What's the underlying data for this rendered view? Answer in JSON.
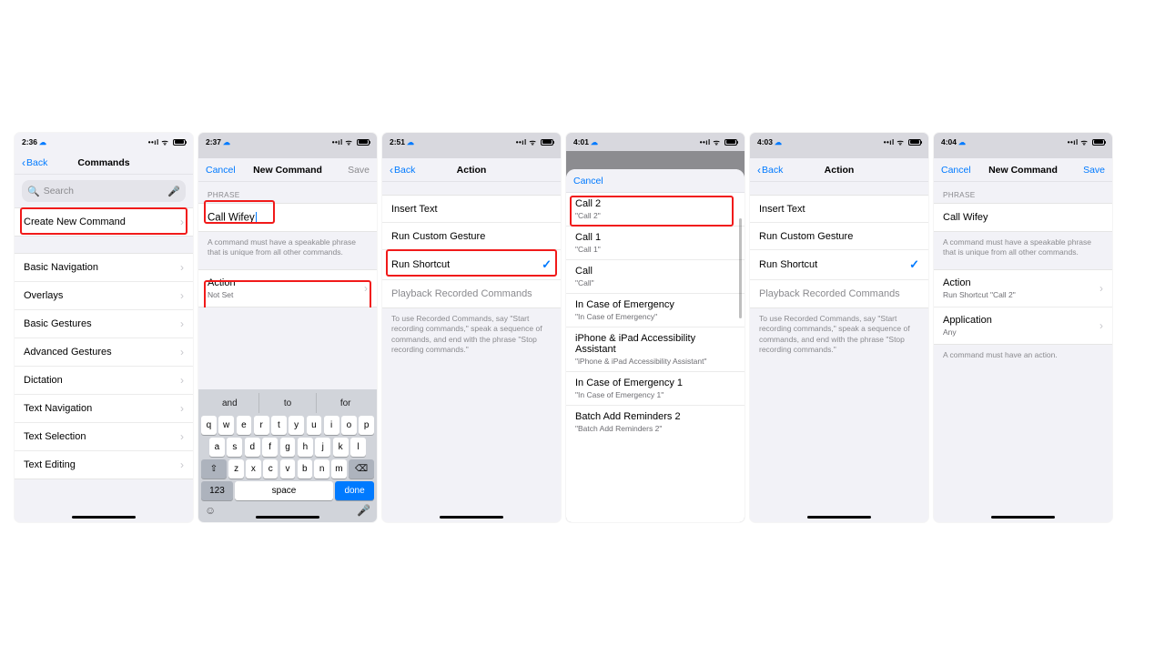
{
  "screens": [
    {
      "time": "2:36",
      "nav": {
        "back": "Back",
        "title": "Commands"
      },
      "search_placeholder": "Search",
      "create_label": "Create New Command",
      "categories": [
        "Basic Navigation",
        "Overlays",
        "Basic Gestures",
        "Advanced Gestures",
        "Dictation",
        "Text Navigation",
        "Text Selection",
        "Text Editing"
      ]
    },
    {
      "time": "2:37",
      "nav": {
        "cancel": "Cancel",
        "title": "New Command",
        "save": "Save"
      },
      "phrase_label": "PHRASE",
      "phrase_value": "Call Wifey",
      "phrase_hint": "A command must have a speakable phrase that is unique from all other commands.",
      "action_label": "Action",
      "action_value": "Not Set",
      "suggestions": [
        "and",
        "to",
        "for"
      ],
      "keys_r1": [
        "q",
        "w",
        "e",
        "r",
        "t",
        "y",
        "u",
        "i",
        "o",
        "p"
      ],
      "keys_r2": [
        "a",
        "s",
        "d",
        "f",
        "g",
        "h",
        "j",
        "k",
        "l"
      ],
      "keys_r3": [
        "z",
        "x",
        "c",
        "v",
        "b",
        "n",
        "m"
      ],
      "keys_bottom": {
        "num": "123",
        "space": "space",
        "done": "done"
      }
    },
    {
      "time": "2:51",
      "nav": {
        "back": "Back",
        "title": "Action"
      },
      "options": [
        "Insert Text",
        "Run Custom Gesture",
        "Run Shortcut",
        "Playback Recorded Commands"
      ],
      "selected": "Run Shortcut",
      "disabled": "Playback Recorded Commands",
      "hint": "To use Recorded Commands, say \"Start recording commands,\" speak a sequence of commands, and end with the phrase \"Stop recording commands.\""
    },
    {
      "time": "4:01",
      "nav": {
        "cancel": "Cancel"
      },
      "shortcuts": [
        {
          "t": "Call 2",
          "s": "\"Call 2\""
        },
        {
          "t": "Call 1",
          "s": "\"Call 1\""
        },
        {
          "t": "Call",
          "s": "\"Call\""
        },
        {
          "t": "In Case of Emergency",
          "s": "\"In Case of Emergency\""
        },
        {
          "t": "iPhone & iPad Accessibility Assistant",
          "s": "\"iPhone & iPad Accessibility Assistant\""
        },
        {
          "t": "In Case of Emergency 1",
          "s": "\"In Case of Emergency 1\""
        },
        {
          "t": "Batch Add Reminders 2",
          "s": "\"Batch Add Reminders 2\""
        }
      ]
    },
    {
      "time": "4:03",
      "nav": {
        "back": "Back",
        "title": "Action"
      },
      "options": [
        "Insert Text",
        "Run Custom Gesture",
        "Run Shortcut",
        "Playback Recorded Commands"
      ],
      "selected": "Run Shortcut",
      "disabled": "Playback Recorded Commands",
      "hint": "To use Recorded Commands, say \"Start recording commands,\" speak a sequence of commands, and end with the phrase \"Stop recording commands.\""
    },
    {
      "time": "4:04",
      "nav": {
        "cancel": "Cancel",
        "title": "New Command",
        "save": "Save"
      },
      "phrase_label": "PHRASE",
      "phrase_value": "Call Wifey",
      "phrase_hint": "A command must have a speakable phrase that is unique from all other commands.",
      "rows": [
        {
          "t": "Action",
          "s": "Run Shortcut \"Call 2\""
        },
        {
          "t": "Application",
          "s": "Any"
        }
      ],
      "action_hint": "A command must have an action."
    }
  ]
}
